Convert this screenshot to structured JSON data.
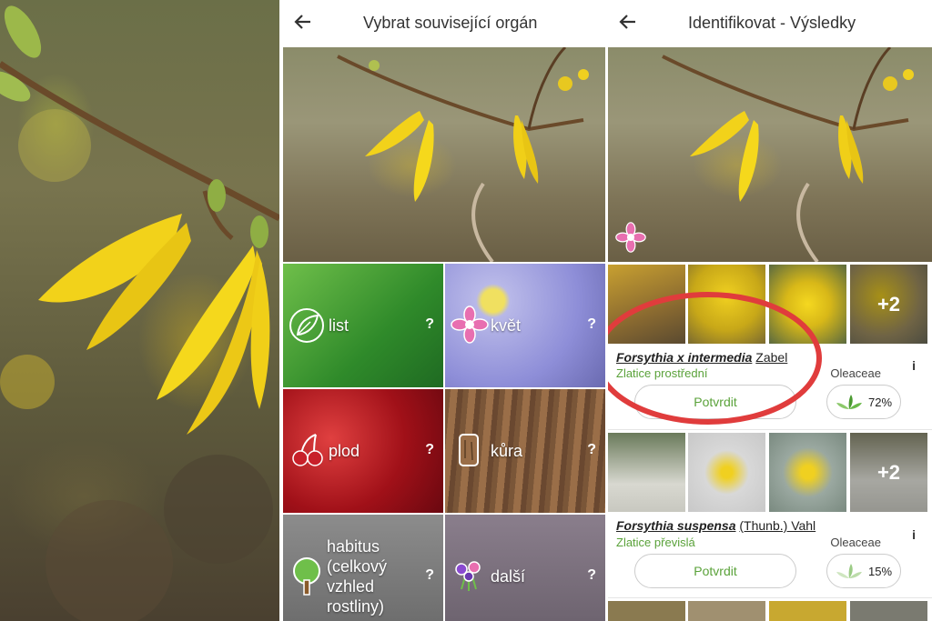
{
  "panel2": {
    "title": "Vybrat související orgán",
    "organs": [
      {
        "label": "list",
        "help": "?"
      },
      {
        "label": "květ",
        "help": "?"
      },
      {
        "label": "plod",
        "help": "?"
      },
      {
        "label": "kůra",
        "help": "?"
      },
      {
        "label": "habitus (celkový vzhled rostliny)",
        "help": "?"
      },
      {
        "label": "další",
        "help": "?"
      }
    ]
  },
  "panel3": {
    "title": "Identifikovat - Výsledky",
    "results": [
      {
        "species": "Forsythia x intermedia",
        "author": "Zabel",
        "common_name": "Zlatice prostřední",
        "family": "Oleaceae",
        "info": "i",
        "more_images": "+2",
        "confirm_label": "Potvrdit",
        "score": "72%"
      },
      {
        "species": "Forsythia suspensa",
        "author": "(Thunb.) Vahl",
        "common_name": "Zlatice převislá",
        "family": "Oleaceae",
        "info": "i",
        "more_images": "+2",
        "confirm_label": "Potvrdit",
        "score": "15%"
      }
    ]
  },
  "colors": {
    "accent_green": "#5aa23a",
    "annotation_red": "#e03c3c",
    "petal_pink": "#e86fb0"
  }
}
